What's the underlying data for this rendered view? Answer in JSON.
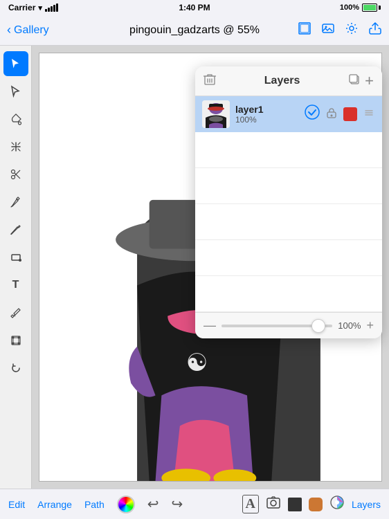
{
  "status_bar": {
    "carrier": "Carrier",
    "time": "1:40 PM",
    "signal": "100%",
    "wifi": true,
    "battery_full": true
  },
  "top_nav": {
    "back_label": "Gallery",
    "title": "pingouin_gadzarts @ 55%",
    "icons": [
      "frame-icon",
      "image-icon",
      "settings-icon",
      "share-icon"
    ]
  },
  "toolbar": {
    "tools": [
      {
        "name": "select-tool",
        "icon": "▲",
        "active": true
      },
      {
        "name": "subselect-tool",
        "icon": "✦",
        "active": false
      },
      {
        "name": "paint-bucket-tool",
        "icon": "◆",
        "active": false
      },
      {
        "name": "transform-tool",
        "icon": "✛",
        "active": false
      },
      {
        "name": "scissors-tool",
        "icon": "✂",
        "active": false
      },
      {
        "name": "pen-tool",
        "icon": "✒",
        "active": false
      },
      {
        "name": "pencil-tool",
        "icon": "✏",
        "active": false
      },
      {
        "name": "rectangle-tool",
        "icon": "▭",
        "active": false
      },
      {
        "name": "text-tool",
        "icon": "T",
        "active": false
      },
      {
        "name": "eyedropper-tool",
        "icon": "⊕",
        "active": false
      },
      {
        "name": "crop-tool",
        "icon": "⊞",
        "active": false
      },
      {
        "name": "rotate-tool",
        "icon": "↺",
        "active": false
      }
    ]
  },
  "layers_panel": {
    "title": "Layers",
    "layer1": {
      "name": "layer1",
      "opacity": "100%",
      "visible": true,
      "locked": false,
      "color": "#d9302a"
    },
    "zoom": {
      "value": "100%",
      "min": "-",
      "max": "+"
    }
  },
  "bottom_toolbar": {
    "items": [
      "Edit",
      "Arrange",
      "Path"
    ],
    "color_picker": true,
    "undo": "↩",
    "redo": "↪",
    "text_icon": "A",
    "camera_icon": "⊙",
    "shape_icons": [
      "■",
      "◼",
      "⊞"
    ],
    "layers_label": "Layers"
  }
}
